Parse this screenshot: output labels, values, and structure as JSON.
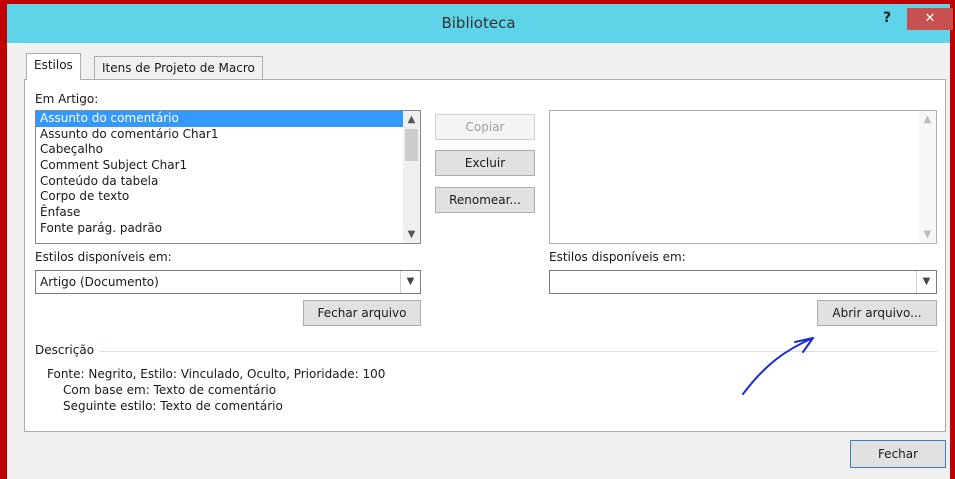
{
  "window": {
    "title": "Biblioteca",
    "help_label": "?",
    "close_label": "✕"
  },
  "tabs": [
    {
      "label": "Estilos",
      "active": true
    },
    {
      "label": "Itens de Projeto de Macro",
      "active": false
    }
  ],
  "left": {
    "list_label": "Em Artigo:",
    "items": [
      "Assunto do comentário",
      "Assunto do comentário Char1",
      "Cabeçalho",
      "Comment Subject Char1",
      "Conteúdo da tabela",
      "Corpo de texto",
      "Ênfase",
      "Fonte parág. padrão"
    ],
    "selected_index": 0,
    "available_label": "Estilos disponíveis em:",
    "available_value": "Artigo (Documento)",
    "close_file_label": "Fechar arquivo"
  },
  "middle": {
    "copy_label": "Copiar",
    "delete_label": "Excluir",
    "rename_label": "Renomear..."
  },
  "right": {
    "available_label": "Estilos disponíveis em:",
    "available_value": "",
    "open_file_label": "Abrir arquivo..."
  },
  "description": {
    "label": "Descrição",
    "lines": [
      "Fonte: Negrito, Estilo: Vinculado, Oculto, Prioridade: 100",
      "Com base em: Texto de comentário",
      "Seguinte estilo: Texto de comentário"
    ]
  },
  "footer": {
    "close_label": "Fechar"
  },
  "colors": {
    "titlebar": "#5fd4e8",
    "frame": "#c00000",
    "selection": "#3399ff",
    "annotation_arrow": "#1a2bd1"
  },
  "icons": {
    "scroll_up": "▲",
    "scroll_down": "▼",
    "dropdown": "▼"
  }
}
